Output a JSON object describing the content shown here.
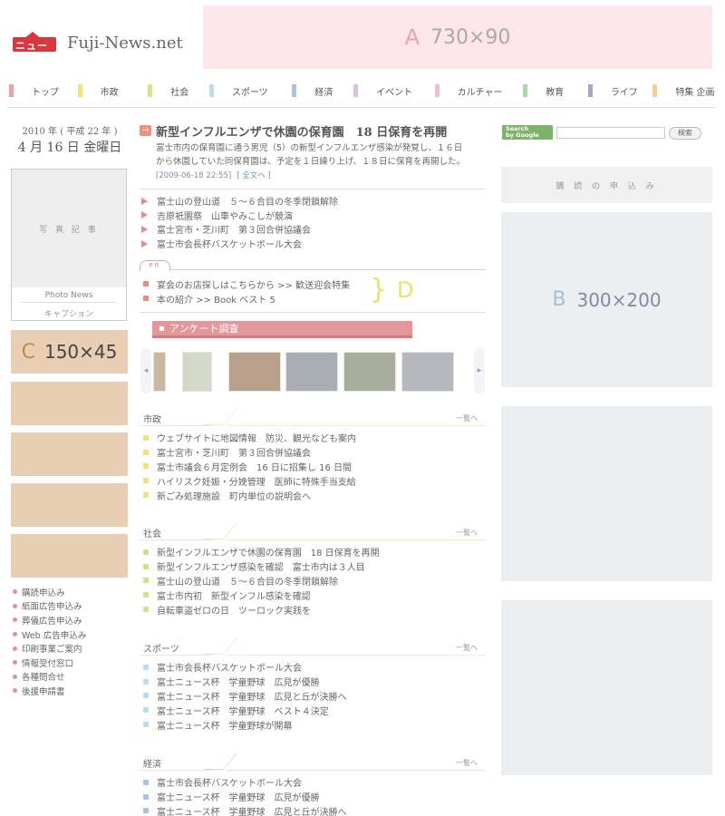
{
  "site": {
    "logo_mark_text": "ニュース",
    "logo_text": "Fuji-News.net"
  },
  "ads": {
    "a": {
      "letter": "A",
      "size": "730×90"
    },
    "b": {
      "letter": "B",
      "size": "300×200"
    },
    "c": {
      "letter": "C",
      "size": "150×45"
    },
    "d": {
      "brace": "}",
      "letter": "D"
    }
  },
  "nav": [
    {
      "label": "トップ",
      "color": "#f3a0a4"
    },
    {
      "label": "市政",
      "color": "#f6e27a"
    },
    {
      "label": "社会",
      "color": "#cfe88a"
    },
    {
      "label": "スポーツ",
      "color": "#b5e0ec"
    },
    {
      "label": "経済",
      "color": "#a8c4e2"
    },
    {
      "label": "イベント",
      "color": "#d7c2e6"
    },
    {
      "label": "カルチャー",
      "color": "#f2bcd6"
    },
    {
      "label": "教育",
      "color": "#a6dba6"
    },
    {
      "label": "ライフ",
      "color": "#a4a4cc"
    },
    {
      "label": "特集 企画",
      "color": "#f4cf94"
    }
  ],
  "date": {
    "year": "2010 年 ( 平成 22 年 )",
    "day": "4 月 16 日 金曜日"
  },
  "photo": {
    "placeholder": "写 真 記 事",
    "label": "Photo News",
    "caption": "キャプション"
  },
  "side_links": [
    "購読申込み",
    "紙面広告申込み",
    "葬儀広告申込み",
    "Web 広告申込み",
    "印刷事業ご案内",
    "情報受付窓口",
    "各種問合せ",
    "後援申請書"
  ],
  "top_story": {
    "icon": "→",
    "title": "新型インフルエンザで休園の保育園　18 日保育を再開",
    "body_line1": "富士市内の保育園に通う男児（5）の新型インフルエンザ感染が発覚し、１６日",
    "body_line2": "から休園していた同保育園は、予定を１日繰り上げ、１８日に保育を再開した。",
    "meta": "[2009-06-18 22:55]",
    "more": "[ 全文へ ]"
  },
  "headlines": [
    "富士山の登山道　５～６合目の冬季閉鎖解除",
    "吉原祇園祭　山車やみこしが競演",
    "富士宮市・芝川町　第３回合併協議会",
    "富士市会長杯バスケットボール大会"
  ],
  "pr": {
    "tab": "PR",
    "links": [
      "宴会のお店探しはこちらから  >>  歓送迎会特集",
      "本の紹介  >>  Book ベスト 5"
    ]
  },
  "survey": {
    "label": "アンケート調査"
  },
  "carousel": {
    "left": "◂",
    "right": "▸"
  },
  "sections": [
    {
      "title": "市政",
      "more": "一覧へ",
      "color": "#f2e27a",
      "items": [
        "ウェブサイトに地図情報　防災、観光なども案内",
        "富士宮市・芝川町　第３回合併協議会",
        "富士市議会６月定例会　16 日に招集し 16 日間",
        "ハイリスク妊娠・分娩管理　医師に特殊手当支給",
        "新ごみ処理施設　町内単位の説明会へ"
      ]
    },
    {
      "title": "社会",
      "more": "一覧へ",
      "color": "#cfe38a",
      "items": [
        "新型インフルエンザで休園の保育園　18 日保育を再開",
        "新型インフルエンザ感染を確認　富士市内は３人目",
        "富士山の登山道　５～６合目の冬季閉鎖解除",
        "富士市内初　新型インフル感染を確認",
        "自転車盗ゼロの日　ツーロック実践を"
      ]
    },
    {
      "title": "スポーツ",
      "more": "一覧へ",
      "color": "#b5e0ec",
      "items": [
        "富士市会長杯バスケットボール大会",
        "富士ニュース杯　学童野球　広見が優勝",
        "富士ニュース杯　学童野球　広見と丘が決勝へ",
        "富士ニュース杯　学童野球　ベスト４決定",
        "富士ニュース杯　学童野球が開幕"
      ]
    },
    {
      "title": "経済",
      "more": "一覧へ",
      "color": "#a8c4e2",
      "items": [
        "富士市会長杯バスケットボール大会",
        "富士ニュース杯　学童野球　広見が優勝",
        "富士ニュース杯　学童野球　広見と丘が決勝へ"
      ]
    }
  ],
  "search": {
    "badge_line1": "Search",
    "badge_line2": "by Google",
    "button": "検索"
  },
  "subscribe": "購 読 の 申 込 み"
}
